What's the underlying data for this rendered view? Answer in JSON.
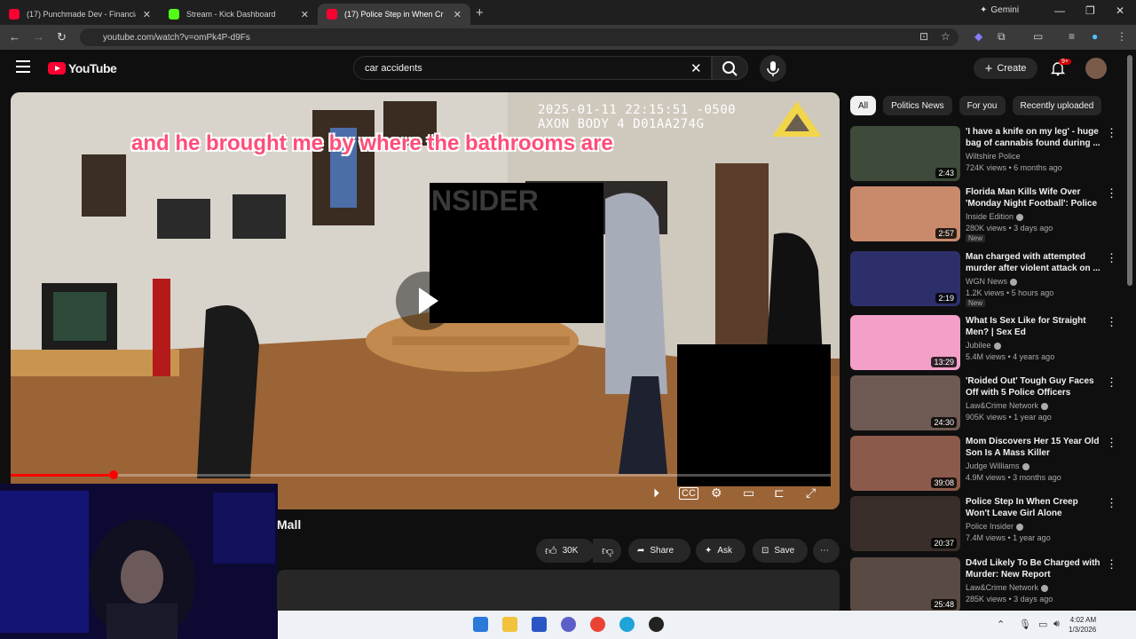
{
  "browser": {
    "tabs": [
      {
        "title": "(17) Punchmade Dev - Financia",
        "color": "#ff0033"
      },
      {
        "title": "Stream - Kick Dashboard",
        "color": "#53fc18"
      },
      {
        "title": "(17) Police Step in When Cr",
        "color": "#ff0033",
        "active": true
      }
    ],
    "gemini_label": "Gemini",
    "url": "youtube.com/watch?v=omPk4P-d9Fs"
  },
  "youtube": {
    "logo_text": "YouTube",
    "search_value": "car accidents",
    "create_label": "Create",
    "notif_count": "9+"
  },
  "player": {
    "caption": "and he brought me by where the bathrooms are",
    "timestamp_line1": "2025-01-11 22:15:51 -0500",
    "timestamp_line2": "AXON BODY 4 D01AA274G",
    "watermark": "NSIDER",
    "progress": 0.12
  },
  "video": {
    "title_fragment": "Mall",
    "likes": "30K",
    "share_label": "Share",
    "ask_label": "Ask",
    "save_label": "Save"
  },
  "chips": [
    "All",
    "Politics News",
    "For you",
    "Recently uploaded"
  ],
  "recommendations": [
    {
      "title": "'I have a knife on my leg' - huge bag of cannabis found during ...",
      "channel": "Wiltshire Police",
      "verified": false,
      "meta": "724K views • 6 months ago",
      "duration": "2:43",
      "new": "",
      "thumb": "#3e4a3a"
    },
    {
      "title": "Florida Man Kills Wife Over 'Monday Night Football': Police",
      "channel": "Inside Edition",
      "verified": true,
      "meta": "280K views • 3 days ago",
      "duration": "2:57",
      "new": "New",
      "thumb": "#c98a6c"
    },
    {
      "title": "Man charged with attempted murder after violent attack on ...",
      "channel": "WGN News",
      "verified": true,
      "meta": "1.2K views • 5 hours ago",
      "duration": "2:19",
      "new": "New",
      "thumb": "#2d2f6b"
    },
    {
      "title": "What Is Sex Like for Straight Men? | Sex Ed",
      "channel": "Jubilee",
      "verified": true,
      "meta": "5.4M views • 4 years ago",
      "duration": "13:29",
      "new": "",
      "thumb": "#f2a0c8"
    },
    {
      "title": "'Roided Out' Tough Guy Faces Off with 5 Police Officers",
      "channel": "Law&Crime Network",
      "verified": true,
      "meta": "905K views • 1 year ago",
      "duration": "24:30",
      "new": "",
      "thumb": "#6e5a52"
    },
    {
      "title": "Mom Discovers Her 15 Year Old Son Is A Mass Killer",
      "channel": "Judge Williams",
      "verified": true,
      "meta": "4.9M views • 3 months ago",
      "duration": "39:08",
      "new": "",
      "thumb": "#8b5a4a"
    },
    {
      "title": "Police Step In When Creep Won't Leave Girl Alone",
      "channel": "Police Insider",
      "verified": true,
      "meta": "7.4M views • 1 year ago",
      "duration": "20:37",
      "new": "",
      "thumb": "#3a2e2a"
    },
    {
      "title": "D4vd Likely To Be Charged with Murder: New Report",
      "channel": "Law&Crime Network",
      "verified": true,
      "meta": "285K views • 3 days ago",
      "duration": "25:48",
      "new": "",
      "thumb": "#5a4a44"
    }
  ],
  "taskbar": {
    "time": "4:02 AM",
    "date": "1/3/2026"
  }
}
